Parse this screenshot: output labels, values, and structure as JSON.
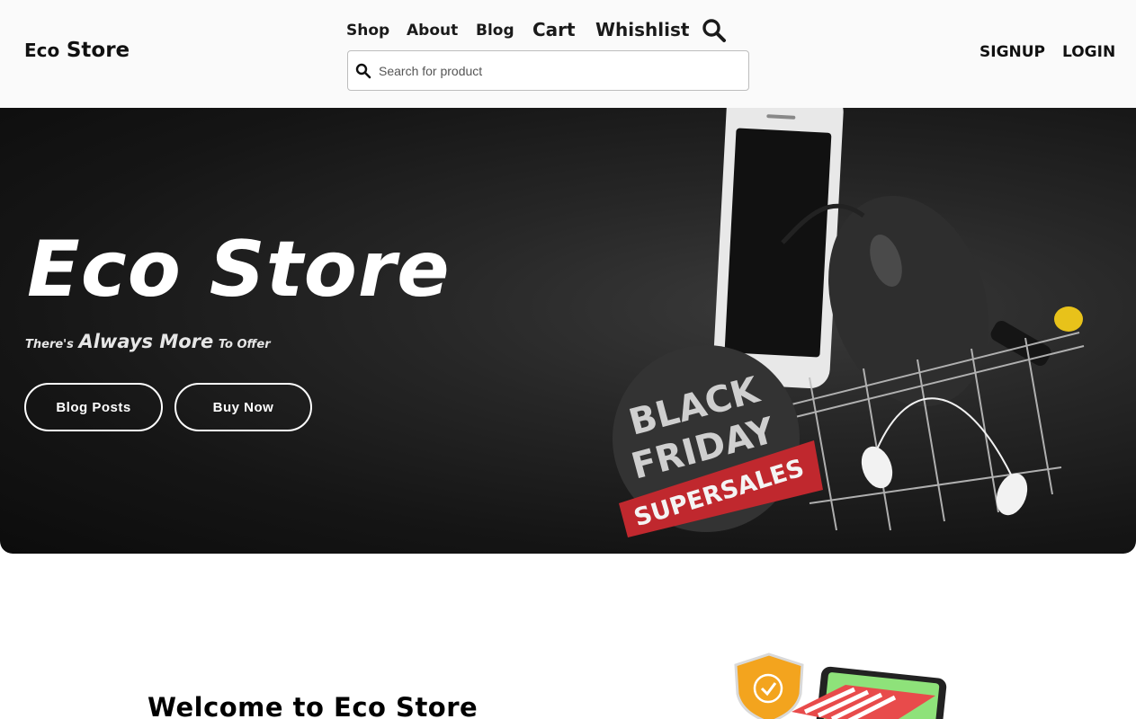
{
  "header": {
    "logo": {
      "prefix": "Eco",
      "name": "Store"
    },
    "nav": {
      "shop": "Shop",
      "about": "About",
      "blog": "Blog",
      "cart": "Cart",
      "wishlist": "Whishlist"
    },
    "search": {
      "placeholder": "Search for product",
      "value": ""
    },
    "auth": {
      "signup": "SIGNUP",
      "login": "LOGIN"
    }
  },
  "hero": {
    "title": "Eco Store",
    "tagline": {
      "part1": "There's",
      "part2": "Always More",
      "part3": "To Offer"
    },
    "buttons": {
      "blog_posts": "Blog Posts",
      "buy_now": "Buy Now"
    },
    "badge": {
      "line1": "BLACK",
      "line2": "FRIDAY",
      "line3": "SUPERSALES"
    }
  },
  "welcome": {
    "title": "Welcome to Eco Store"
  },
  "colors": {
    "hero_bg": "#1c1c1c",
    "badge_red": "#c0282e",
    "badge_dark": "#333333",
    "accent_orange": "#f3a41e"
  }
}
